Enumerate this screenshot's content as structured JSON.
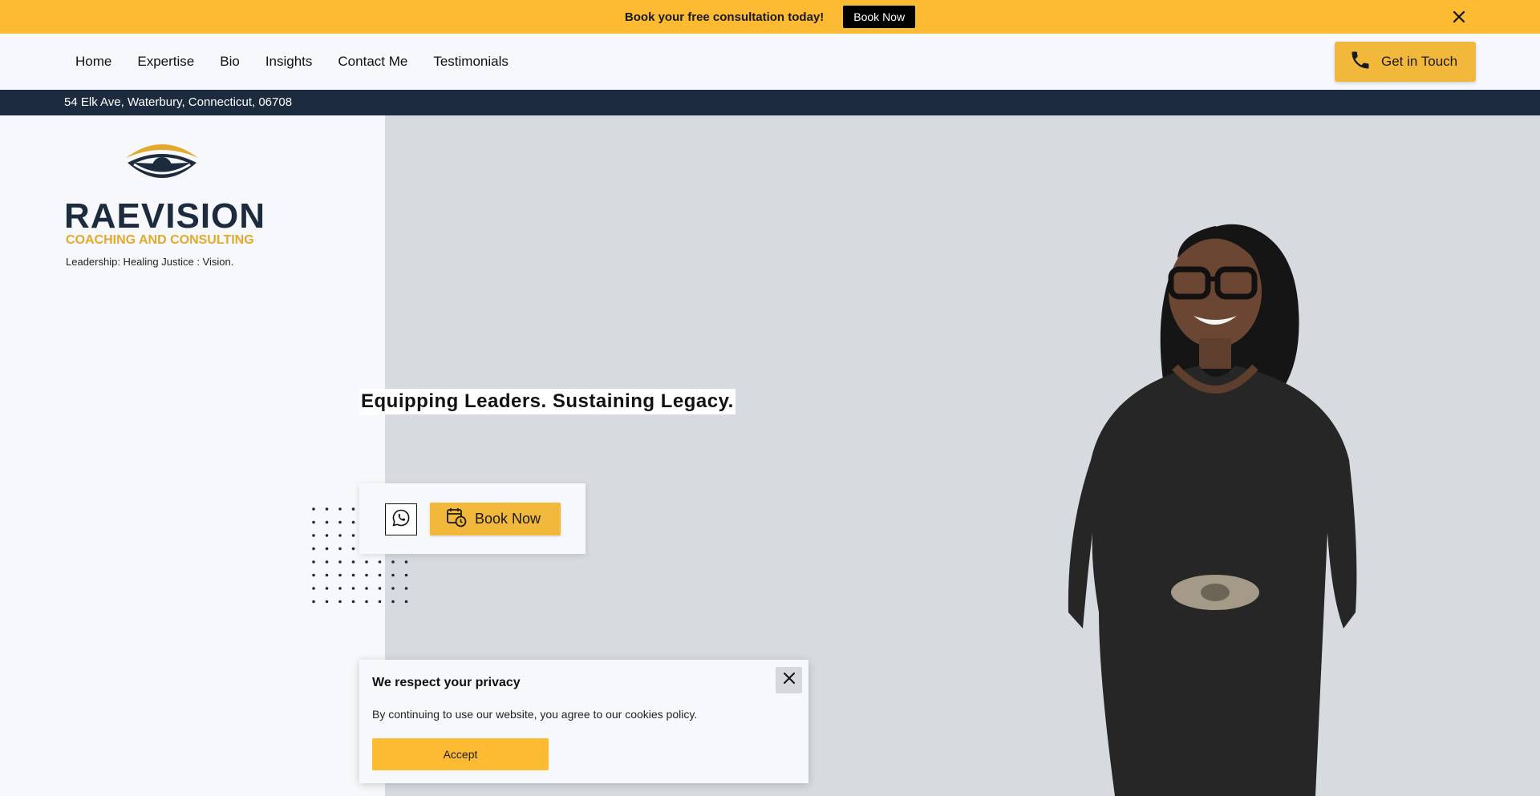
{
  "promo": {
    "text": "Book your free consultation today!",
    "button_label": "Book Now",
    "close_icon": "close-icon"
  },
  "nav": {
    "links": [
      "Home",
      "Expertise",
      "Bio",
      "Insights",
      "Contact Me",
      "Testimonials"
    ],
    "cta_label": "Get in Touch",
    "cta_icon": "phone-icon"
  },
  "address": "54 Elk Ave, Waterbury, Connecticut, 06708",
  "logo": {
    "name": "RAEVISION",
    "subtitle": "COACHING AND CONSULTING",
    "tagline": "Leadership: Healing Justice : Vision.",
    "icon": "eye-icon"
  },
  "hero": {
    "headline": "Equipping Leaders. Sustaining Legacy.",
    "whatsapp_icon": "whatsapp-icon",
    "book_label": "Book Now",
    "book_icon": "calendar-clock-icon"
  },
  "cookie": {
    "title": "We respect your privacy",
    "body": "By continuing to use our website, you agree to our cookies policy.",
    "accept_label": "Accept"
  },
  "colors": {
    "accent": "#fdbb33",
    "navy": "#1d2b3e",
    "hero_bg": "#d7dbdf"
  }
}
